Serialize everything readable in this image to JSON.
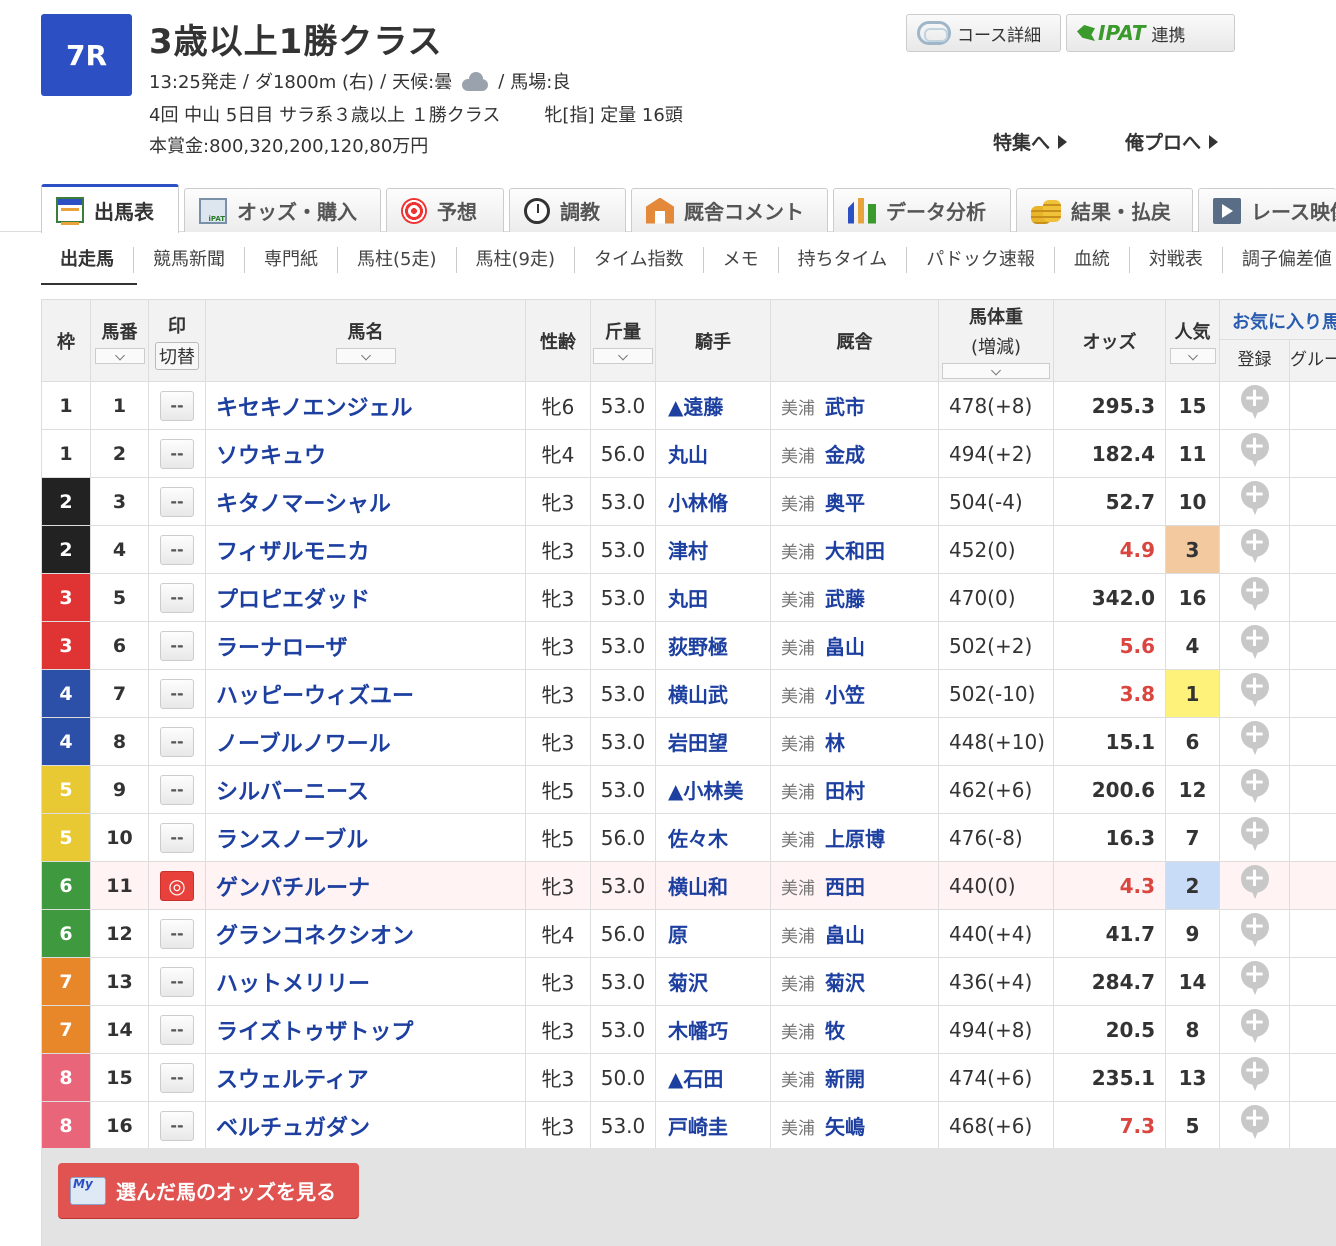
{
  "header": {
    "race_no": "7R",
    "title": "3歳以上1勝クラス",
    "start_time": "13:25発走",
    "course": "ダ1800m (右)",
    "weather_label": "天候:曇",
    "track": "馬場:良",
    "meeting": "4回 中山 5日目 サラ系３歳以上 １勝クラス",
    "conditions": "牝[指] 定量 16頭",
    "prize": "本賞金:800,320,200,120,80万円",
    "course_detail": "コース詳細",
    "ipat_logo": "IPAT",
    "ipat_link": "連携",
    "tokushu": "特集へ",
    "orepro": "俺プロへ"
  },
  "tabs": [
    {
      "label": "出馬表"
    },
    {
      "label": "オッズ・購入"
    },
    {
      "label": "予想"
    },
    {
      "label": "調教"
    },
    {
      "label": "厩舎コメント"
    },
    {
      "label": "データ分析"
    },
    {
      "label": "結果・払戻"
    },
    {
      "label": "レース映像"
    }
  ],
  "subtabs": [
    "出走馬",
    "競馬新聞",
    "専門紙",
    "馬柱(5走)",
    "馬柱(9走)",
    "タイム指数",
    "メモ",
    "持ちタイム",
    "パドック速報",
    "血統",
    "対戦表",
    "調子偏差値"
  ],
  "table": {
    "h_waku": "枠",
    "h_umaban": "馬番",
    "h_mark": "印",
    "h_mark_toggle": "切替",
    "h_name": "馬名",
    "h_sexage": "性齢",
    "h_weight": "斤量",
    "h_jockey": "騎手",
    "h_trainer": "厩舎",
    "h_bw1": "馬体重",
    "h_bw2": "(増減)",
    "h_odds": "オッズ",
    "h_pop": "人気",
    "h_fav": "お気に入り馬",
    "h_fav_reg": "登録",
    "h_fav_grp": "グループ",
    "rows": [
      {
        "waku": "1",
        "umaban": "1",
        "mark": "--",
        "name": "キセキノエンジェル",
        "sexage": "牝6",
        "weight": "53.0",
        "jockey": "▲遠藤",
        "area": "美浦",
        "trainer": "武市",
        "bw": "478(+8)",
        "odds": "295.3",
        "pop": "15"
      },
      {
        "waku": "1",
        "umaban": "2",
        "mark": "--",
        "name": "ソウキュウ",
        "sexage": "牝4",
        "weight": "56.0",
        "jockey": "丸山",
        "area": "美浦",
        "trainer": "金成",
        "bw": "494(+2)",
        "odds": "182.4",
        "pop": "11"
      },
      {
        "waku": "2",
        "umaban": "3",
        "mark": "--",
        "name": "キタノマーシャル",
        "sexage": "牝3",
        "weight": "53.0",
        "jockey": "小林脩",
        "area": "美浦",
        "trainer": "奥平",
        "bw": "504(-4)",
        "odds": "52.7",
        "pop": "10"
      },
      {
        "waku": "2",
        "umaban": "4",
        "mark": "--",
        "name": "フィザルモニカ",
        "sexage": "牝3",
        "weight": "53.0",
        "jockey": "津村",
        "area": "美浦",
        "trainer": "大和田",
        "bw": "452(0)",
        "odds": "4.9",
        "pop": "3"
      },
      {
        "waku": "3",
        "umaban": "5",
        "mark": "--",
        "name": "プロピエダッド",
        "sexage": "牝3",
        "weight": "53.0",
        "jockey": "丸田",
        "area": "美浦",
        "trainer": "武藤",
        "bw": "470(0)",
        "odds": "342.0",
        "pop": "16"
      },
      {
        "waku": "3",
        "umaban": "6",
        "mark": "--",
        "name": "ラーナローザ",
        "sexage": "牝3",
        "weight": "53.0",
        "jockey": "荻野極",
        "area": "美浦",
        "trainer": "畠山",
        "bw": "502(+2)",
        "odds": "5.6",
        "pop": "4"
      },
      {
        "waku": "4",
        "umaban": "7",
        "mark": "--",
        "name": "ハッピーウィズユー",
        "sexage": "牝3",
        "weight": "53.0",
        "jockey": "横山武",
        "area": "美浦",
        "trainer": "小笠",
        "bw": "502(-10)",
        "odds": "3.8",
        "pop": "1"
      },
      {
        "waku": "4",
        "umaban": "8",
        "mark": "--",
        "name": "ノーブルノワール",
        "sexage": "牝3",
        "weight": "53.0",
        "jockey": "岩田望",
        "area": "美浦",
        "trainer": "林",
        "bw": "448(+10)",
        "odds": "15.1",
        "pop": "6"
      },
      {
        "waku": "5",
        "umaban": "9",
        "mark": "--",
        "name": "シルバーニース",
        "sexage": "牝5",
        "weight": "53.0",
        "jockey": "▲小林美",
        "area": "美浦",
        "trainer": "田村",
        "bw": "462(+6)",
        "odds": "200.6",
        "pop": "12"
      },
      {
        "waku": "5",
        "umaban": "10",
        "mark": "--",
        "name": "ランスノーブル",
        "sexage": "牝5",
        "weight": "56.0",
        "jockey": "佐々木",
        "area": "美浦",
        "trainer": "上原博",
        "bw": "476(-8)",
        "odds": "16.3",
        "pop": "7"
      },
      {
        "waku": "6",
        "umaban": "11",
        "mark": "◎",
        "name": "ゲンパチルーナ",
        "sexage": "牝3",
        "weight": "53.0",
        "jockey": "横山和",
        "area": "美浦",
        "trainer": "西田",
        "bw": "440(0)",
        "odds": "4.3",
        "pop": "2"
      },
      {
        "waku": "6",
        "umaban": "12",
        "mark": "--",
        "name": "グランコネクシオン",
        "sexage": "牝4",
        "weight": "56.0",
        "jockey": "原",
        "area": "美浦",
        "trainer": "畠山",
        "bw": "440(+4)",
        "odds": "41.7",
        "pop": "9"
      },
      {
        "waku": "7",
        "umaban": "13",
        "mark": "--",
        "name": "ハットメリリー",
        "sexage": "牝3",
        "weight": "53.0",
        "jockey": "菊沢",
        "area": "美浦",
        "trainer": "菊沢",
        "bw": "436(+4)",
        "odds": "284.7",
        "pop": "14"
      },
      {
        "waku": "7",
        "umaban": "14",
        "mark": "--",
        "name": "ライズトゥザトップ",
        "sexage": "牝3",
        "weight": "53.0",
        "jockey": "木幡巧",
        "area": "美浦",
        "trainer": "牧",
        "bw": "494(+8)",
        "odds": "20.5",
        "pop": "8"
      },
      {
        "waku": "8",
        "umaban": "15",
        "mark": "--",
        "name": "スウェルティア",
        "sexage": "牝3",
        "weight": "50.0",
        "jockey": "▲石田",
        "area": "美浦",
        "trainer": "新開",
        "bw": "474(+6)",
        "odds": "235.1",
        "pop": "13"
      },
      {
        "waku": "8",
        "umaban": "16",
        "mark": "--",
        "name": "ベルチュガダン",
        "sexage": "牝3",
        "weight": "53.0",
        "jockey": "戸崎圭",
        "area": "美浦",
        "trainer": "矢嶋",
        "bw": "468(+6)",
        "odds": "7.3",
        "pop": "5"
      }
    ]
  },
  "colors": {
    "race_badge": "#2c4fc4",
    "waku": {
      "1": "#ffffff",
      "2": "#222222",
      "3": "#e03434",
      "4": "#2c4fa8",
      "5": "#e8c934",
      "6": "#3f9a3f",
      "7": "#e8862a",
      "8": "#e8657a"
    },
    "pop_1": "#fff27a",
    "pop_2": "#c8dcf7",
    "pop_3": "#f3c9a0",
    "hot_odds": "#d9453f"
  },
  "footer": {
    "my_badge": "My",
    "button": "選んだ馬のオッズを見る"
  }
}
